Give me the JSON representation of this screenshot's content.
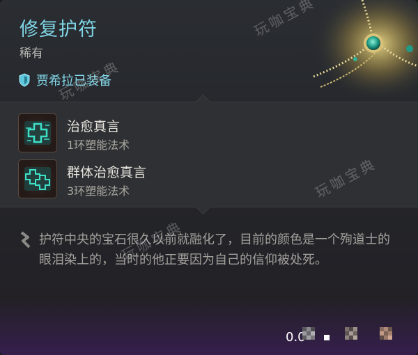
{
  "item": {
    "title": "修复护符",
    "rarity": "稀有",
    "equipped_by": "贾希拉已装备",
    "spells": [
      {
        "name": "治愈真言",
        "level": "1环塑能法术",
        "icon": "healing-word-icon"
      },
      {
        "name": "群体治愈真言",
        "level": "3环塑能法术",
        "icon": "mass-healing-word-icon"
      }
    ],
    "description": "护符中央的宝石很久以前就融化了，目前的颜色是一个殉道士的眼泪染上的，当时的他正要因为自己的信仰被处死。"
  },
  "watermarks": [
    "玩咖宝典",
    "玩咖宝典",
    "玩咖宝典",
    "玩咖宝典"
  ],
  "footer": {
    "value": "0.0"
  },
  "colors": {
    "title": "#7fd6e6",
    "equipped": "#83d9ea",
    "spell_icon_glow": "#3fe0c8",
    "background": "#26282c"
  }
}
